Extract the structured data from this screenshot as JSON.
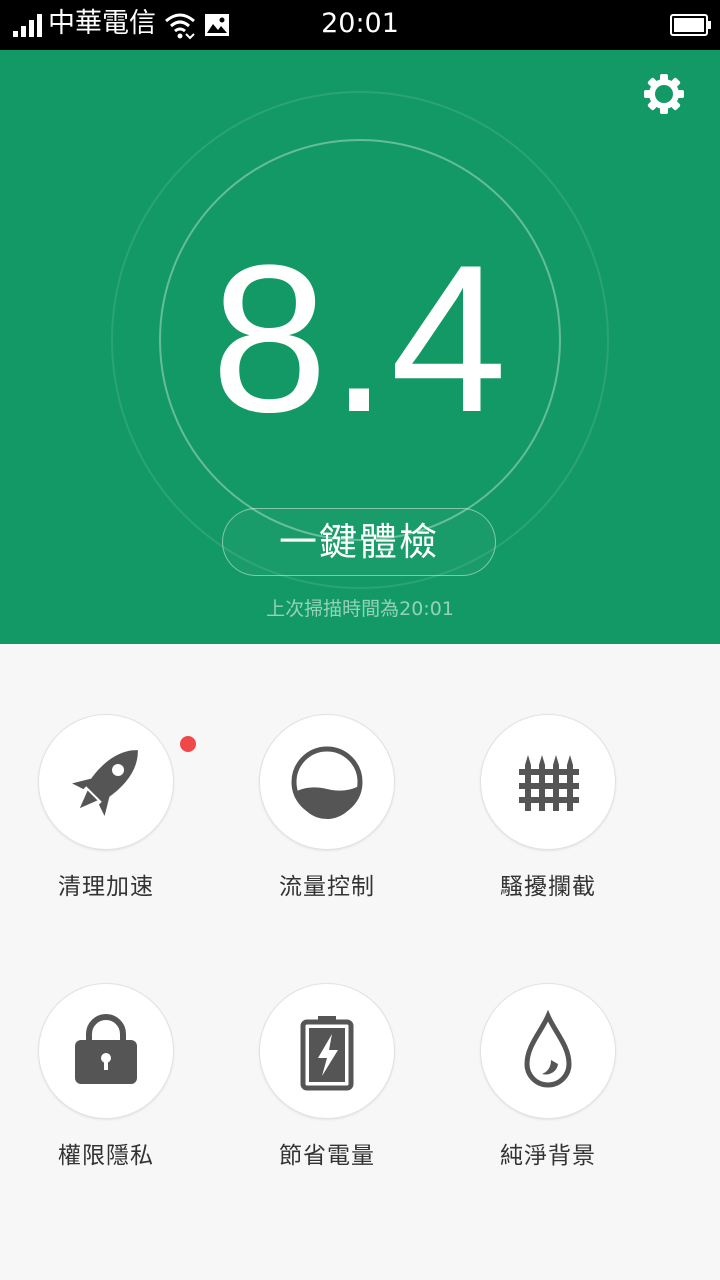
{
  "status_bar": {
    "carrier": "中華電信",
    "time": "20:01"
  },
  "header": {
    "score": "8.4",
    "check_button_label": "一鍵體檢",
    "last_scan": "上次掃描時間為20:01",
    "background_color": "#139966"
  },
  "features": [
    {
      "label": "清理加速",
      "icon": "rocket-icon",
      "has_badge": true
    },
    {
      "label": "流量控制",
      "icon": "data-gauge-icon",
      "has_badge": false
    },
    {
      "label": "騷擾攔截",
      "icon": "fence-icon",
      "has_badge": false
    },
    {
      "label": "權限隱私",
      "icon": "lock-icon",
      "has_badge": false
    },
    {
      "label": "節省電量",
      "icon": "battery-charging-icon",
      "has_badge": false
    },
    {
      "label": "純淨背景",
      "icon": "water-drop-icon",
      "has_badge": false
    }
  ],
  "colors": {
    "accent": "#139966",
    "badge": "#f04848",
    "icon": "#555555"
  }
}
